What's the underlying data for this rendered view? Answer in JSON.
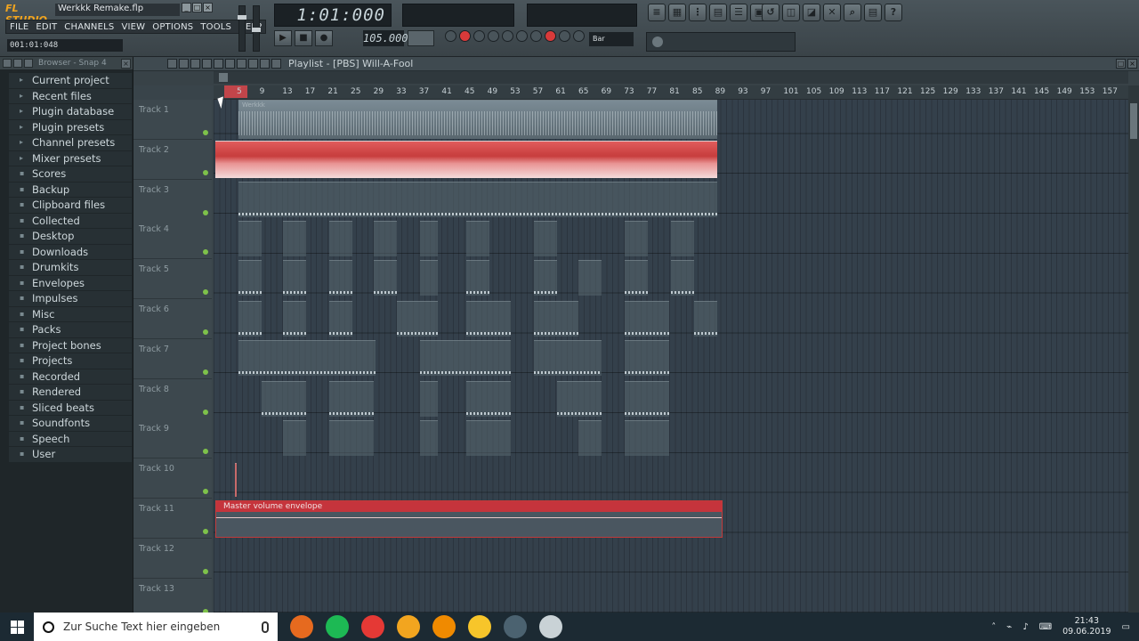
{
  "window": {
    "app_name": "FL STUDIO",
    "project_title": "Werkkk Remake.flp",
    "hint": "001:01:048"
  },
  "menu": [
    "FILE",
    "EDIT",
    "CHANNELS",
    "VIEW",
    "OPTIONS",
    "TOOLS",
    "HELP"
  ],
  "transport": {
    "song_time": "1:01:000",
    "tempo": "105.000",
    "snap": "Bar"
  },
  "browser": {
    "header": "Browser - Snap 4",
    "items": [
      {
        "label": "Current project",
        "icon": "project-icon"
      },
      {
        "label": "Recent files",
        "icon": "recent-icon"
      },
      {
        "label": "Plugin database",
        "icon": "plugin-icon"
      },
      {
        "label": "Plugin presets",
        "icon": "plugin-icon"
      },
      {
        "label": "Channel presets",
        "icon": "preset-icon"
      },
      {
        "label": "Mixer presets",
        "icon": "preset-icon"
      },
      {
        "label": "Scores",
        "icon": "folder-icon"
      },
      {
        "label": "Backup",
        "icon": "folder-icon"
      },
      {
        "label": "Clipboard files",
        "icon": "folder-icon"
      },
      {
        "label": "Collected",
        "icon": "folder-icon"
      },
      {
        "label": "Desktop",
        "icon": "folder-icon"
      },
      {
        "label": "Downloads",
        "icon": "folder-icon"
      },
      {
        "label": "Drumkits",
        "icon": "folder-icon"
      },
      {
        "label": "Envelopes",
        "icon": "folder-icon"
      },
      {
        "label": "Impulses",
        "icon": "folder-icon"
      },
      {
        "label": "Misc",
        "icon": "folder-icon"
      },
      {
        "label": "Packs",
        "icon": "folder-icon"
      },
      {
        "label": "Project bones",
        "icon": "folder-icon"
      },
      {
        "label": "Projects",
        "icon": "folder-icon"
      },
      {
        "label": "Recorded",
        "icon": "folder-icon"
      },
      {
        "label": "Rendered",
        "icon": "folder-icon"
      },
      {
        "label": "Sliced beats",
        "icon": "folder-icon"
      },
      {
        "label": "Soundfonts",
        "icon": "folder-icon"
      },
      {
        "label": "Speech",
        "icon": "folder-icon"
      },
      {
        "label": "User",
        "icon": "user-icon"
      }
    ]
  },
  "playlist": {
    "title": "Playlist - [PBS] Will-A-Fool",
    "ruler": [
      "5",
      "9",
      "13",
      "17",
      "21",
      "25",
      "29",
      "33",
      "37",
      "41",
      "45",
      "49",
      "53",
      "57",
      "61",
      "65",
      "69",
      "73",
      "77",
      "81",
      "85",
      "89",
      "93",
      "97",
      "101",
      "105",
      "109",
      "113",
      "117",
      "121",
      "125",
      "129",
      "133",
      "137",
      "141",
      "145",
      "149",
      "153",
      "157"
    ],
    "tracks": [
      "Track 1",
      "Track 2",
      "Track 3",
      "Track 4",
      "Track 5",
      "Track 6",
      "Track 7",
      "Track 8",
      "Track 9",
      "Track 10",
      "Track 11",
      "Track 12",
      "Track 13"
    ],
    "audio_clip_label": "Werkkk",
    "envelope_label": "Master volume envelope"
  },
  "taskbar": {
    "search_placeholder": "Zur Suche Text hier eingeben",
    "time": "21:43",
    "date": "09.06.2019",
    "apps": [
      {
        "name": "firefox-icon",
        "color": "#e66a1f"
      },
      {
        "name": "spotify-icon",
        "color": "#1db954"
      },
      {
        "name": "recorder-icon",
        "color": "#e53935"
      },
      {
        "name": "flstudio-icon",
        "color": "#f2a51f"
      },
      {
        "name": "vlc-icon",
        "color": "#f08a00"
      },
      {
        "name": "fl-fruit-icon",
        "color": "#f7c52a"
      },
      {
        "name": "app-icon",
        "color": "#4b6270"
      },
      {
        "name": "clock-app-icon",
        "color": "#c9d2d6"
      }
    ]
  }
}
